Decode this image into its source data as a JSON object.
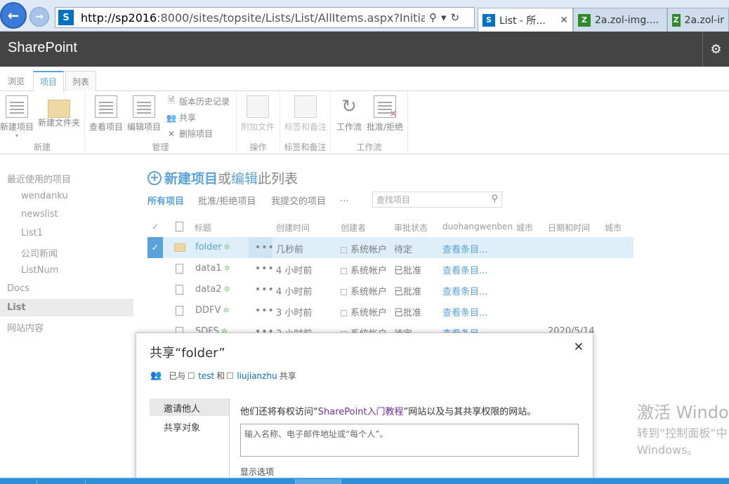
{
  "browser": {
    "url_host": "http://sp2016",
    "url_rest": ":8000/sites/topsite/Lists/List/AllItems.aspx?InitialTabI",
    "tabs": [
      {
        "label": "List - 所...",
        "active": true
      },
      {
        "label": "2a.zol-img....",
        "active": false
      },
      {
        "label": "2a.zol-ir",
        "active": false
      }
    ]
  },
  "suite": {
    "brand": "SharePoint"
  },
  "ribbon": {
    "tabs": [
      "浏览",
      "项目",
      "列表"
    ],
    "groups": {
      "new": {
        "label": "新建",
        "new_item": "新建项目",
        "new_folder": "新建文件夹"
      },
      "manage": {
        "label": "管理",
        "view_item": "查看项目",
        "edit_item": "编辑项目",
        "version_history": "版本历史记录",
        "share": "共享",
        "delete_item": "删除项目"
      },
      "actions": {
        "label": "操作",
        "attach_file": "附加文件"
      },
      "tags": {
        "label": "标签和备注",
        "tags_notes": "标签和备注"
      },
      "workflows": {
        "label": "工作流",
        "workflow": "工作流",
        "approve_reject": "批准/拒绝"
      }
    }
  },
  "left_nav": {
    "recent": "最近使用的项目",
    "recent_items": [
      "wendanku",
      "newslist",
      "List1",
      "公司新闻",
      "ListNum"
    ],
    "docs": "Docs",
    "list": "List",
    "site_contents": "网站内容"
  },
  "main": {
    "new_item_text": {
      "new_item": "新建项目",
      "or": "或",
      "edit": "编辑",
      "this_list": "此列表"
    },
    "views": [
      "所有项目",
      "批准/拒绝项目",
      "我提交的项目",
      "…"
    ],
    "search_placeholder": "查找项目",
    "columns": [
      "标题",
      "创建时间",
      "创建者",
      "审批状态",
      "duohangwenben",
      "城市",
      "日期和时间",
      "城市"
    ],
    "rows": [
      {
        "title": "folder",
        "created": "几秒前",
        "author": "系统帐户",
        "status": "待定",
        "link": "查看条目...",
        "date": ""
      },
      {
        "title": "data1",
        "created": "4 小时前",
        "author": "系统帐户",
        "status": "已批准",
        "link": "查看条目...",
        "date": ""
      },
      {
        "title": "data2",
        "created": "4 小时前",
        "author": "系统帐户",
        "status": "已批准",
        "link": "查看条目...",
        "date": ""
      },
      {
        "title": "DDFV",
        "created": "3 小时前",
        "author": "系统帐户",
        "status": "已批准",
        "link": "查看条目...",
        "date": ""
      },
      {
        "title": "SDFS",
        "created": "3 小时前",
        "author": "系统帐户",
        "status": "待定",
        "link": "查看条目...",
        "date": "2020/5/14"
      }
    ]
  },
  "dialog": {
    "title": "共享“folder”",
    "shared_prefix": "已与",
    "user1": "test",
    "and": "和",
    "user2": "liujianzhu",
    "shared_suffix": "共享",
    "invite": "邀请他人",
    "shared_with": "共享对象",
    "msg_prefix": "他们还将有权访问“",
    "site_name": "SharePoint入门教程",
    "msg_suffix": "”网站以及与其共享权限的网站。",
    "input_placeholder": "输入名称、电子邮件地址或“每个人”。",
    "show_options": "显示选项"
  },
  "watermark": {
    "line1": "激活 Windo",
    "line2": "转到“控制面板”中",
    "line3": "Windows。"
  },
  "colors": {
    "accent": "#0072c6",
    "suite_bar": "#444444",
    "selected_row": "#cde6f7"
  }
}
